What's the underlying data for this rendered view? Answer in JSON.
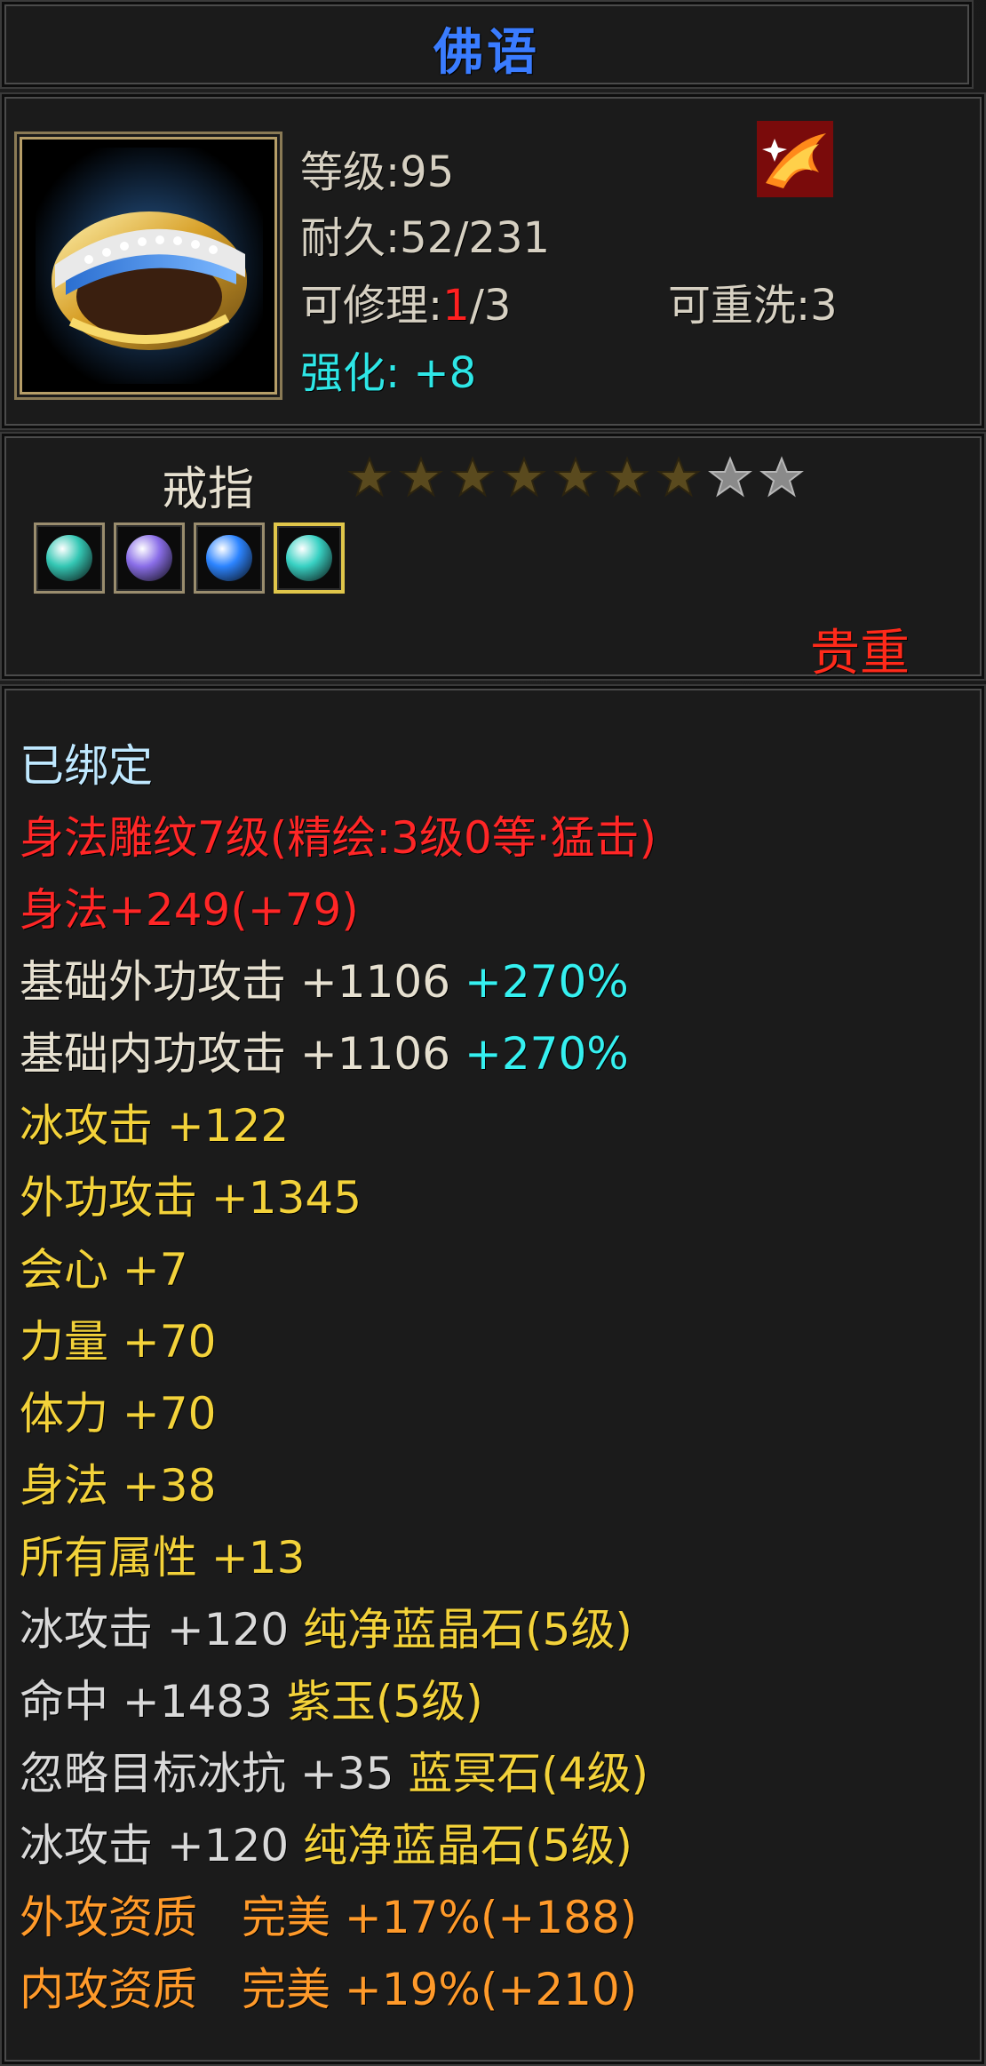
{
  "title": "佛语",
  "header": {
    "level": "等级:95",
    "durability": "耐久:52/231",
    "repair_label": "可修理:",
    "repair_current": "1",
    "repair_total": "/3",
    "rewash": "可重洗:3",
    "enhance": "强化: +8",
    "item_icon": "gold-ring",
    "badge_icon": "phoenix-icon"
  },
  "type": {
    "label": "戒指",
    "stars_total": 9,
    "stars_filled": 7,
    "gems": [
      {
        "name": "green-gem",
        "color": "#34c7b4"
      },
      {
        "name": "purple-gem",
        "color": "#8a6ee8"
      },
      {
        "name": "blue-gem",
        "color": "#2c84ff"
      },
      {
        "name": "green-gem",
        "color": "#38d1c3"
      }
    ],
    "rarity": "贵重"
  },
  "body": {
    "bound": "已绑定",
    "engraving": "身法雕纹7级(精绘:3级0等·猛击)",
    "agility_bonus": "身法+249(+79)",
    "lines": [
      {
        "text": "基础外功攻击 +1106 ",
        "extra": "+270%"
      },
      {
        "text": "基础内功攻击 +1106 ",
        "extra": "+270%"
      },
      {
        "text": "冰攻击 +122"
      },
      {
        "text": "外功攻击 +1345"
      },
      {
        "text": "会心 +7"
      },
      {
        "text": "力量 +70"
      },
      {
        "text": "体力 +70"
      },
      {
        "text": "身法 +38"
      },
      {
        "text": "所有属性 +13"
      }
    ],
    "gem_lines": [
      {
        "stat": "冰攻击 +120 ",
        "gem": "纯净蓝晶石(5级)"
      },
      {
        "stat": "命中 +1483 ",
        "gem": "紫玉(5级)"
      },
      {
        "stat": "忽略目标冰抗 +35 ",
        "gem": "蓝冥石(4级)"
      },
      {
        "stat": "冰攻击 +120 ",
        "gem": "纯净蓝晶石(5级)"
      }
    ],
    "quality_lines": [
      "外攻资质　完美 +17%(+188)",
      "内攻资质　完美 +19%(+210)"
    ]
  }
}
